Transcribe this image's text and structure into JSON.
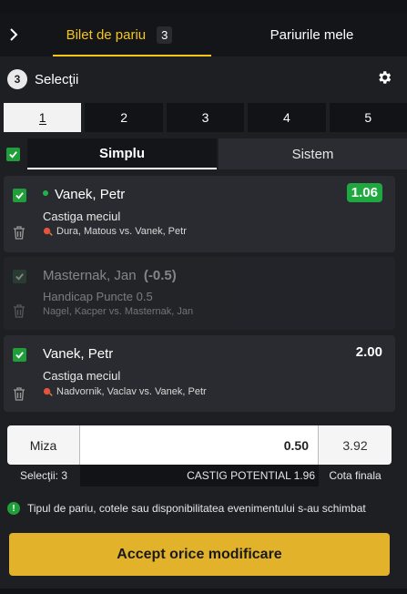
{
  "tabs": {
    "bilet_label": "Bilet de pariu",
    "bilet_count": "3",
    "mele_label": "Pariurile mele"
  },
  "selections": {
    "count": "3",
    "label": "Selecţii"
  },
  "number_tabs": [
    "1",
    "2",
    "3",
    "4",
    "5"
  ],
  "mode": {
    "simplu": "Simplu",
    "sistem": "Sistem"
  },
  "bets": [
    {
      "player": "Vanek, Petr",
      "market": "Castiga meciul",
      "match": "Dura, Matous vs. Vanek, Petr",
      "odds": "1.06"
    },
    {
      "player": "Masternak, Jan",
      "handicap": "(-0.5)",
      "market": "Handicap Puncte 0.5",
      "match": "Nagel, Kacper vs. Masternak, Jan"
    },
    {
      "player": "Vanek, Petr",
      "market": "Castiga meciul",
      "match": "Nadvornik, Vaclav vs. Vanek, Petr",
      "odds": "2.00"
    }
  ],
  "stake": {
    "label": "Miza",
    "value": "0.50",
    "total_odds": "3.92",
    "selections_text": "Selecţii: 3",
    "potential_win": "CASTIG POTENTIAL 1.96",
    "total_odds_label": "Cota finala"
  },
  "notice": "Tipul de pariu, cotele sau disponibilitatea evenimentului s-au schimbat",
  "accept_button": "Accept orice modificare",
  "colors": {
    "accent": "#f5c518",
    "green": "#1fa83f",
    "background": "#1e1f23"
  }
}
